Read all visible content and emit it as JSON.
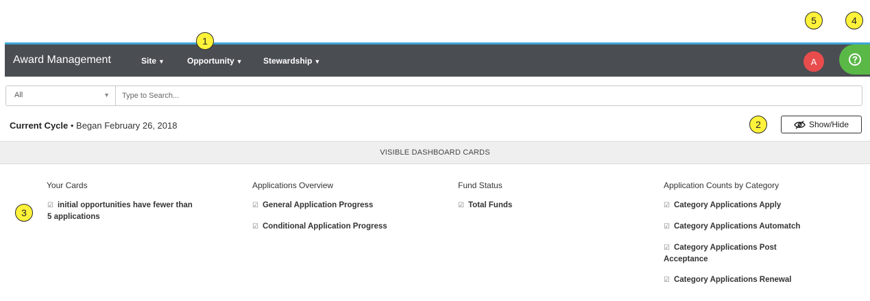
{
  "callouts": {
    "c1": "1",
    "c2": "2",
    "c3": "3",
    "c4": "4",
    "c5": "5"
  },
  "navbar": {
    "brand": "Award Management",
    "items": [
      "Site",
      "Opportunity",
      "Stewardship"
    ],
    "avatar": "A"
  },
  "search": {
    "filter_value": "All",
    "placeholder": "Type to Search..."
  },
  "cycle": {
    "label": "Current Cycle",
    "separator": " • ",
    "began": "Began February 26, 2018"
  },
  "showhide": {
    "label": "Show/Hide"
  },
  "section": {
    "title": "VISIBLE DASHBOARD CARDS"
  },
  "columns": [
    {
      "title": "Your Cards",
      "items": [
        "initial opportunities have fewer than 5 applications"
      ]
    },
    {
      "title": "Applications Overview",
      "items": [
        "General Application Progress",
        "Conditional Application Progress"
      ]
    },
    {
      "title": "Fund Status",
      "items": [
        "Total Funds"
      ]
    },
    {
      "title": "Application Counts by Category",
      "items": [
        "Category Applications Apply",
        "Category Applications Automatch",
        "Category Applications Post Acceptance",
        "Category Applications Renewal"
      ]
    }
  ],
  "colors": {
    "navbar": "#4a4d52",
    "accent_line": "#3fa6d9",
    "help": "#5ab847",
    "avatar": "#e84c4c",
    "callout": "#fff23a"
  }
}
